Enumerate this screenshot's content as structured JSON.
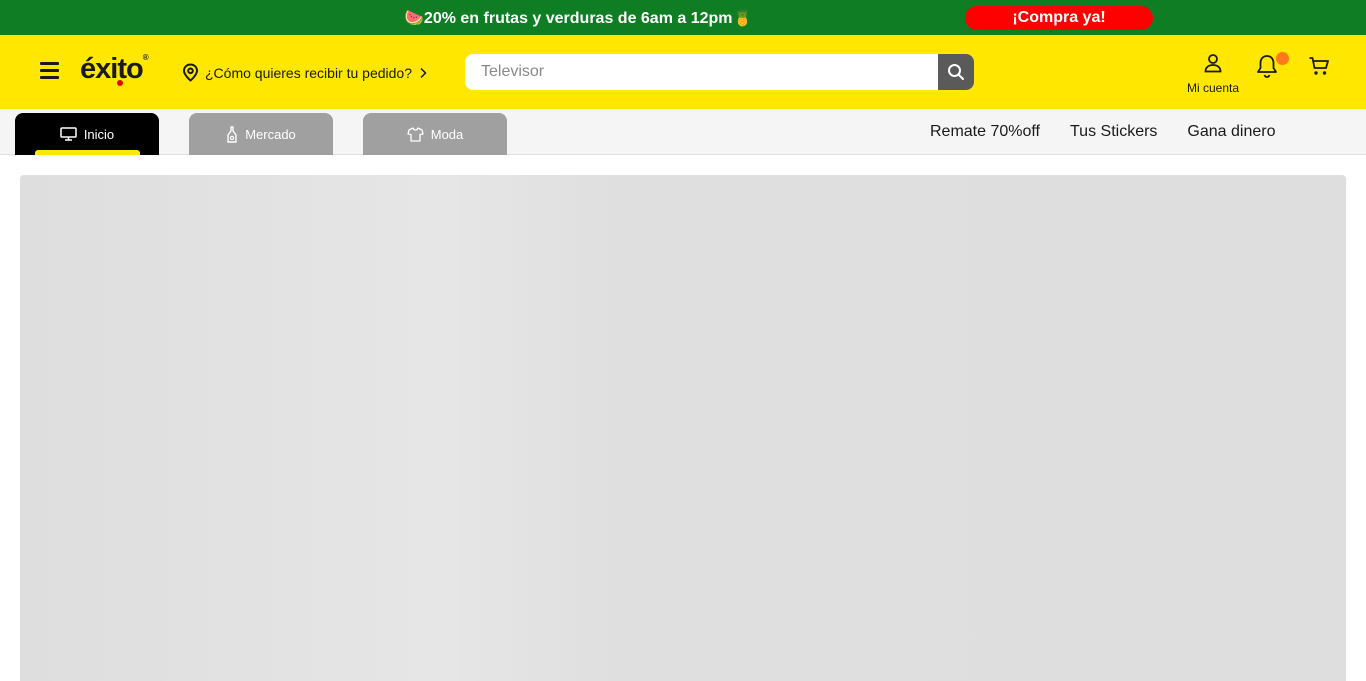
{
  "promo": {
    "text": "🍉20% en frutas y verduras de 6am a 12pm🍍",
    "cta": "¡Compra ya!"
  },
  "header": {
    "logo": "éxito",
    "delivery_label": "¿Cómo quieres recibir tu pedido?",
    "search_placeholder": "Televisor",
    "account_label": "Mi cuenta"
  },
  "nav": {
    "tabs": [
      {
        "label": "Inicio",
        "icon": "monitor-icon",
        "active": true
      },
      {
        "label": "Mercado",
        "icon": "bottle-icon",
        "active": false
      },
      {
        "label": "Moda",
        "icon": "shirt-icon",
        "active": false
      }
    ],
    "links": [
      "Remate 70%off",
      "Tus Stickers",
      "Gana dinero"
    ]
  },
  "colors": {
    "promo_bg": "#0e7d23",
    "cta_bg": "#ff0000",
    "header_bg": "#ffe700",
    "active_tab": "#000000",
    "inactive_tab": "#a0a0a0",
    "notification_dot": "#ff7a1a"
  }
}
